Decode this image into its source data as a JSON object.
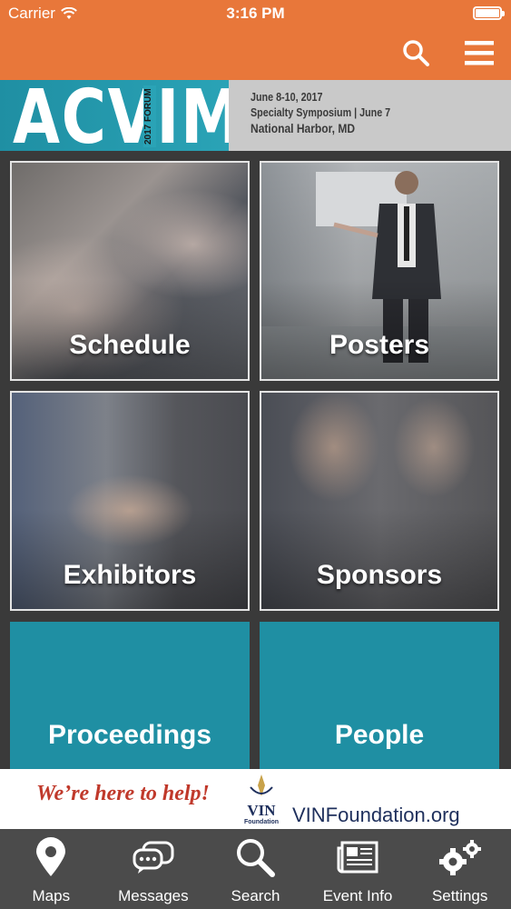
{
  "status": {
    "carrier": "Carrier",
    "time": "3:16 PM"
  },
  "banner": {
    "logo_text": "ACVIM",
    "logo_sub": "2017 FORUM",
    "line1": "June 8-10, 2017",
    "line2": "Specialty Symposium | June 7",
    "line3": "National Harbor, MD"
  },
  "tiles": [
    {
      "label": "Schedule"
    },
    {
      "label": "Posters"
    },
    {
      "label": "Exhibitors"
    },
    {
      "label": "Sponsors"
    },
    {
      "label": "Proceedings"
    },
    {
      "label": "People"
    }
  ],
  "ad": {
    "tagline": "We’re here to help!",
    "brand": "VIN",
    "brand_sub": "Foundation",
    "site": "VINFoundation.org"
  },
  "tabs": [
    {
      "label": "Maps",
      "icon": "map-pin-icon"
    },
    {
      "label": "Messages",
      "icon": "messages-icon"
    },
    {
      "label": "Search",
      "icon": "search-icon"
    },
    {
      "label": "Event Info",
      "icon": "newspaper-icon"
    },
    {
      "label": "Settings",
      "icon": "gears-icon"
    }
  ],
  "colors": {
    "header": "#e8773a",
    "teal": "#1f8fa3",
    "tabbar": "#4b4b4b"
  }
}
